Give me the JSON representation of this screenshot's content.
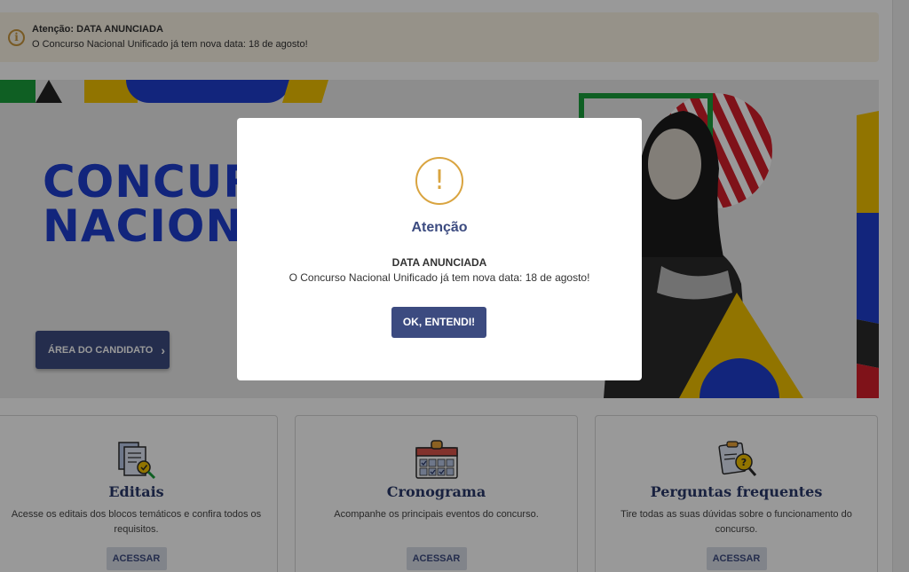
{
  "alert": {
    "title": "Atenção: DATA ANUNCIADA",
    "text": "O Concurso Nacional Unificado já tem nova data: 18 de agosto!",
    "icon": "info-icon"
  },
  "hero": {
    "title_line1": "CONCURSO",
    "title_line2": "NACIONAL",
    "candidate_button": "ÁREA DO CANDIDATO"
  },
  "cards": [
    {
      "title": "Editais",
      "description": "Acesse os editais dos blocos temáticos e confira todos os requisitos.",
      "button": "ACESSAR",
      "icon": "documents-icon"
    },
    {
      "title": "Cronograma",
      "description": "Acompanhe os principais eventos do concurso.",
      "button": "ACESSAR",
      "icon": "calendar-icon"
    },
    {
      "title": "Perguntas frequentes",
      "description": "Tire todas as suas dúvidas sobre o funcionamento do concurso.",
      "button": "ACESSAR",
      "icon": "faq-clipboard-icon"
    }
  ],
  "modal": {
    "icon": "exclamation",
    "title": "Atenção",
    "subtitle": "DATA ANUNCIADA",
    "text": "O Concurso Nacional Unificado já tem nova data: 18 de agosto!",
    "button": "OK, ENTENDI!"
  },
  "colors": {
    "primary": "#3c4b80",
    "hero_blue": "#1f3fcf",
    "warning": "#d9a440",
    "alert_bg": "#faf3e5"
  }
}
